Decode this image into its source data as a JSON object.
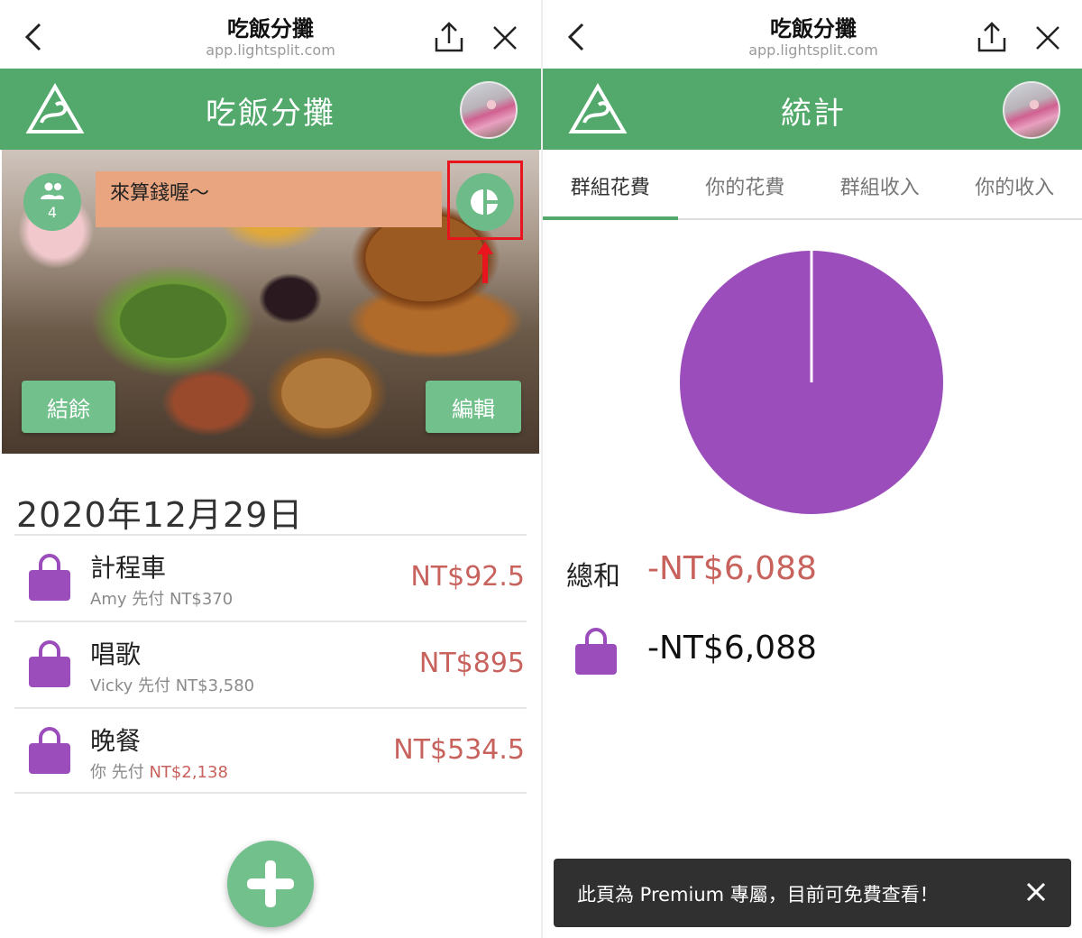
{
  "left": {
    "browser": {
      "title": "吃飯分攤",
      "url": "app.lightsplit.com"
    },
    "header": {
      "title": "吃飯分攤"
    },
    "cover": {
      "member_count": "4",
      "note": "來算錢喔～",
      "settle_label": "結餘",
      "edit_label": "編輯"
    },
    "date": "2020年12月29日",
    "expenses": [
      {
        "title": "計程車",
        "payer": "Amy 先付 NT$370",
        "payer_name": "",
        "payer_amount": "",
        "amount": "NT$92.5"
      },
      {
        "title": "唱歌",
        "payer": "Vicky 先付 NT$3,580",
        "payer_name": "",
        "payer_amount": "",
        "amount": "NT$895"
      },
      {
        "title": "晚餐",
        "payer": "",
        "payer_name": "你 先付 ",
        "payer_amount": "NT$2,138",
        "amount": "NT$534.5"
      }
    ]
  },
  "right": {
    "browser": {
      "title": "吃飯分攤",
      "url": "app.lightsplit.com"
    },
    "header": {
      "title": "統計"
    },
    "tabs": [
      "群組花費",
      "你的花費",
      "群組收入",
      "你的收入"
    ],
    "active_tab": 0,
    "total_label": "總和",
    "total_value": "-NT$6,088",
    "category_value": "-NT$6,088",
    "toast": {
      "message": "此頁為 Premium 專屬，目前可免費查看！"
    }
  },
  "colors": {
    "brand_green": "#52a96b",
    "button_green": "#72c08c",
    "amount_red": "#c8625d",
    "category_purple": "#9b4dbb",
    "note_orange": "#e9a57f",
    "highlight_red": "#e8141e"
  },
  "chart_data": {
    "type": "pie",
    "slices": [
      {
        "value": 6088,
        "color": "#9b4dbb"
      }
    ]
  }
}
